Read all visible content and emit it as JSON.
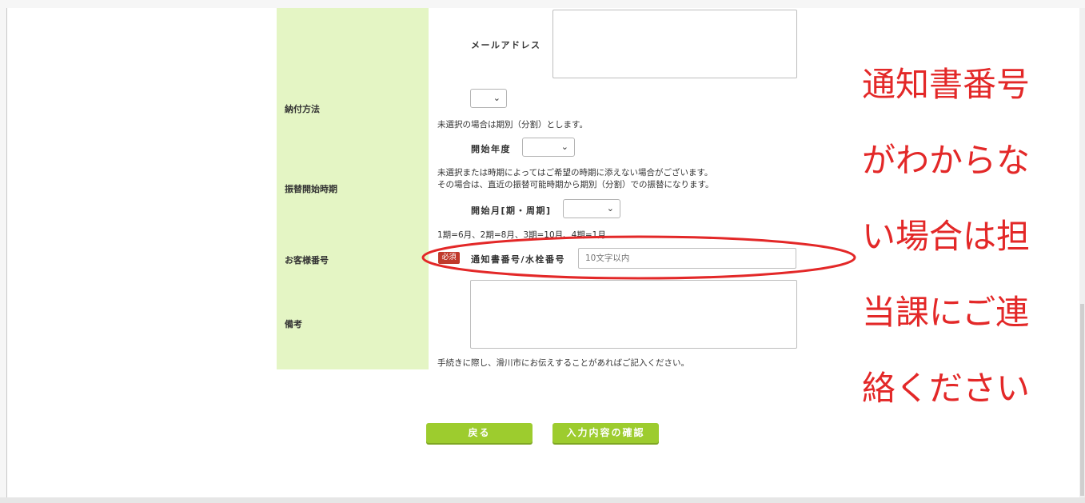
{
  "form": {
    "rows": [
      {
        "label": "納付方法"
      },
      {
        "label": "振替開始時期"
      },
      {
        "label": "お客様番号"
      },
      {
        "label": "備考"
      }
    ],
    "email_label": "メールアドレス",
    "payment_method_note": "未選択の場合は期別（分割）とします。",
    "start_year_label": "開始年度",
    "start_timing_note_1": "未選択または時期によってはご希望の時期に添えない場合がございます。",
    "start_timing_note_2": "その場合は、直近の振替可能時期から期別（分割）での振替になります。",
    "start_month_label": "開始月[期・周期]",
    "period_note": "1期=6月、2期=8月、3期=10月、4期=1月",
    "required_badge": "必須",
    "customer_number_label": "通知書番号/水栓番号",
    "customer_number_placeholder": "10文字以内",
    "remarks_note": "手続きに際し、滑川市にお伝えすることがあればご記入ください。"
  },
  "buttons": {
    "back": "戻る",
    "confirm": "入力内容の確認"
  },
  "annotation": {
    "lines": [
      "通知書番号",
      "がわからな",
      "い場合は担",
      "当課にご連",
      "絡ください"
    ],
    "color": "#e32828"
  },
  "colors": {
    "label_bg": "#e4f5c4",
    "button": "#9dcc2e",
    "required": "#c0392b"
  }
}
